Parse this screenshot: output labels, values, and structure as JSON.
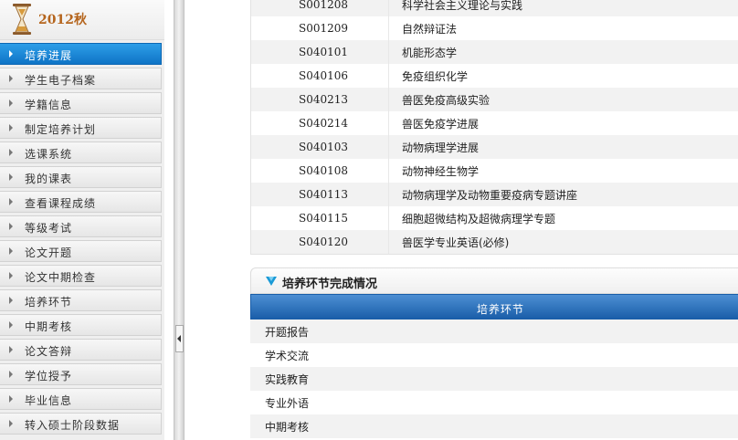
{
  "sidebar": {
    "semester": "2012秋",
    "menu": [
      {
        "label": "培养进展",
        "active": true
      },
      {
        "label": "学生电子档案",
        "active": false
      },
      {
        "label": "学籍信息",
        "active": false
      },
      {
        "label": "制定培养计划",
        "active": false
      },
      {
        "label": "选课系统",
        "active": false
      },
      {
        "label": "我的课表",
        "active": false
      },
      {
        "label": "查看课程成绩",
        "active": false
      },
      {
        "label": "等级考试",
        "active": false
      },
      {
        "label": "论文开题",
        "active": false
      },
      {
        "label": "论文中期检查",
        "active": false
      },
      {
        "label": "培养环节",
        "active": false
      },
      {
        "label": "中期考核",
        "active": false
      },
      {
        "label": "论文答辩",
        "active": false
      },
      {
        "label": "学位授予",
        "active": false
      },
      {
        "label": "毕业信息",
        "active": false
      },
      {
        "label": "转入硕士阶段数据",
        "active": false
      }
    ]
  },
  "courses": [
    {
      "code": "S001208",
      "name": "科学社会主义理论与实践"
    },
    {
      "code": "S001209",
      "name": "自然辩证法"
    },
    {
      "code": "S040101",
      "name": "机能形态学"
    },
    {
      "code": "S040106",
      "name": "免疫组织化学"
    },
    {
      "code": "S040213",
      "name": "兽医免疫高级实验"
    },
    {
      "code": "S040214",
      "name": "兽医免疫学进展"
    },
    {
      "code": "S040103",
      "name": "动物病理学进展"
    },
    {
      "code": "S040108",
      "name": "动物神经生物学"
    },
    {
      "code": "S040113",
      "name": "动物病理学及动物重要疫病专题讲座"
    },
    {
      "code": "S040115",
      "name": "细胞超微结构及超微病理学专题"
    },
    {
      "code": "S040120",
      "name": "兽医学专业英语(必修)"
    }
  ],
  "section": {
    "title": "培养环节完成情况",
    "column_header": "培养环节",
    "rows": [
      "开题报告",
      "学术交流",
      "实践教育",
      "专业外语",
      "中期考核"
    ]
  },
  "colors": {
    "active_menu": "#1a86d6",
    "section_header": "#2a6fbc",
    "semester_text": "#b5651d"
  }
}
